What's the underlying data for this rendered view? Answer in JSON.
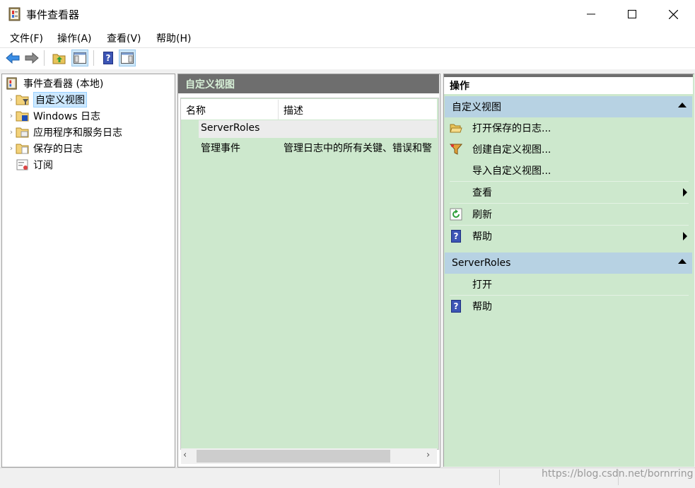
{
  "window": {
    "title": "事件查看器",
    "minimize_glyph": "—",
    "maximize_glyph": "☐",
    "close_glyph": "✕"
  },
  "menu": [
    "文件(F)",
    "操作(A)",
    "查看(V)",
    "帮助(H)"
  ],
  "toolbar": {
    "icons": [
      "back-arrow-icon",
      "forward-arrow-icon",
      "up-folder-icon",
      "show-hide-console-tree-icon",
      "help-icon",
      "show-hide-action-pane-icon"
    ]
  },
  "tree": {
    "root": "事件查看器 (本地)",
    "items": [
      {
        "label": "自定义视图",
        "expandable": true,
        "selected": true
      },
      {
        "label": "Windows 日志",
        "expandable": true
      },
      {
        "label": "应用程序和服务日志",
        "expandable": true
      },
      {
        "label": "保存的日志",
        "expandable": true
      },
      {
        "label": "订阅",
        "expandable": false
      }
    ]
  },
  "center": {
    "header": "自定义视图",
    "columns": [
      "名称",
      "描述"
    ],
    "rows": [
      {
        "name": "ServerRoles",
        "description": ""
      },
      {
        "name": "管理事件",
        "description": "管理日志中的所有关键、错误和警"
      }
    ],
    "scroll_left": "‹",
    "scroll_right": "›"
  },
  "actions": {
    "title": "操作",
    "sections": [
      {
        "header": "自定义视图",
        "items": [
          {
            "label": "打开保存的日志...",
            "icon": "open-folder-icon"
          },
          {
            "label": "创建自定义视图...",
            "icon": "filter-icon"
          },
          {
            "label": "导入自定义视图...",
            "icon": ""
          },
          {
            "label": "查看",
            "icon": "",
            "submenu": true
          },
          {
            "label": "刷新",
            "icon": "refresh-icon"
          },
          {
            "label": "帮助",
            "icon": "help-icon",
            "submenu": true
          }
        ]
      },
      {
        "header": "ServerRoles",
        "items": [
          {
            "label": "打开",
            "icon": ""
          },
          {
            "label": "帮助",
            "icon": "help-icon"
          }
        ]
      }
    ]
  },
  "statusbar": {
    "watermark": "https://blog.csdn.net/bornrring"
  },
  "colors": {
    "pane_green": "#cde8cd",
    "section_blue": "#b7d2e3",
    "header_gray": "#6e6e6e",
    "selection_blue": "#cce8ff"
  }
}
